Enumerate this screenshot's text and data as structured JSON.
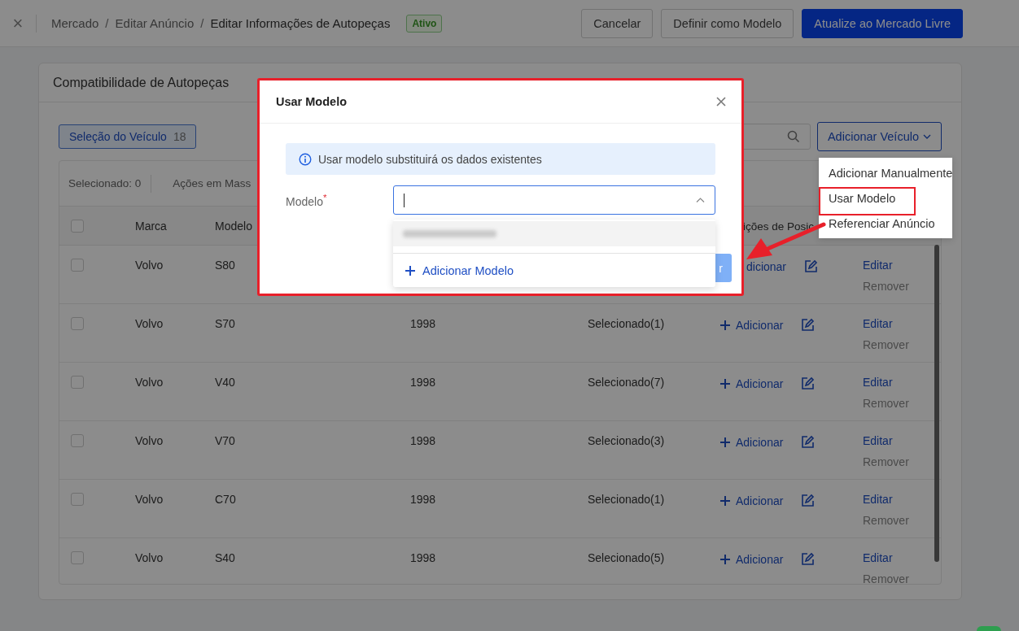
{
  "topbar": {
    "close_icon": "×",
    "breadcrumb": [
      {
        "kind": "link",
        "text": "Mercado"
      },
      {
        "kind": "separator",
        "text": "/"
      },
      {
        "kind": "link",
        "text": "Editar Anúncio"
      },
      {
        "kind": "separator",
        "text": "/"
      },
      {
        "kind": "current",
        "text": "Editar Informações de Autopeças"
      }
    ],
    "status": "Ativo",
    "buttons": [
      {
        "label": "Cancelar",
        "kind": "default"
      },
      {
        "label": "Definir como Modelo",
        "kind": "default"
      },
      {
        "label": "Atualize ao Mercado Livre",
        "kind": "primary"
      }
    ]
  },
  "card": {
    "title": "Compatibilidade de Autopeças",
    "vehicle_tag": {
      "label": "Seleção do Veículo",
      "count": "18"
    },
    "add_vehicle": "Adicionar Veículo",
    "toolbar": {
      "selected": "Selecionado: 0",
      "bulk": "Ações em Mass"
    },
    "header": {
      "checked": false,
      "brand": "Marca",
      "model": "Modelo",
      "positions": "ições de Posic"
    },
    "rows": [
      {
        "checked": false,
        "brand": "Volvo",
        "model": "S80",
        "add_icon": false,
        "add": "dicionar",
        "edit": "Editar",
        "remove": "Remover"
      },
      {
        "checked": false,
        "brand": "Volvo",
        "model": "S70",
        "year": "1998",
        "selected_count": "Selecionado(1)",
        "add_icon": true,
        "add": "Adicionar",
        "edit": "Editar",
        "remove": "Remover"
      },
      {
        "checked": false,
        "brand": "Volvo",
        "model": "V40",
        "year": "1998",
        "selected_count": "Selecionado(7)",
        "add_icon": true,
        "add": "Adicionar",
        "edit": "Editar",
        "remove": "Remover"
      },
      {
        "checked": false,
        "brand": "Volvo",
        "model": "V70",
        "year": "1998",
        "selected_count": "Selecionado(3)",
        "add_icon": true,
        "add": "Adicionar",
        "edit": "Editar",
        "remove": "Remover"
      },
      {
        "checked": false,
        "brand": "Volvo",
        "model": "C70",
        "year": "1998",
        "selected_count": "Selecionado(1)",
        "add_icon": true,
        "add": "Adicionar",
        "edit": "Editar",
        "remove": "Remover"
      },
      {
        "checked": false,
        "brand": "Volvo",
        "model": "S40",
        "year": "1998",
        "selected_count": "Selecionado(5)",
        "add_icon": true,
        "add": "Adicionar",
        "edit": "Editar",
        "remove": "Remover"
      }
    ]
  },
  "add_menu": {
    "items": [
      {
        "label": "Adicionar Manualmente",
        "highlighted": false
      },
      {
        "label": "Usar Modelo",
        "highlighted": true
      },
      {
        "label": "Referenciar Anúncio",
        "highlighted": false
      }
    ]
  },
  "modal": {
    "title": "Usar Modelo",
    "alert": "Usar modelo substituirá os dados existentes",
    "field_label": "Modelo",
    "required": "*",
    "dropdown": {
      "add_option": "Adicionar Modelo"
    },
    "footer_button": "r"
  }
}
